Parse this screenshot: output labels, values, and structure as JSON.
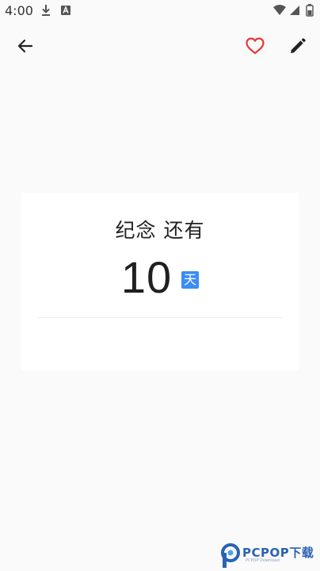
{
  "status_bar": {
    "time": "4:00",
    "left_icons": [
      "download-icon",
      "app-a-icon"
    ],
    "right_icons": [
      "wifi-icon",
      "signal-icon",
      "battery-icon"
    ]
  },
  "toolbar": {
    "back_icon": "arrow-left-icon",
    "favorite_icon": "heart-outline-icon",
    "favorite_color": "#e53935",
    "edit_icon": "pencil-icon"
  },
  "card": {
    "title": "纪念 还有",
    "count": "10",
    "unit": "天",
    "unit_color": "#3c8df7"
  },
  "watermark": {
    "text": "PCPOP下载",
    "subtext": "PCPOP Download"
  }
}
